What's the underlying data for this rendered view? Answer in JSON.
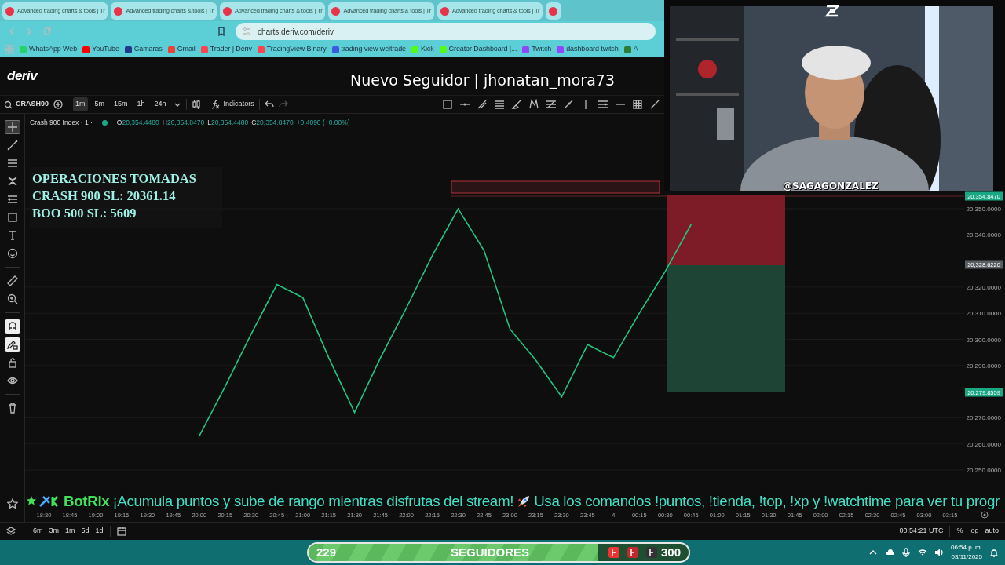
{
  "browser": {
    "tabs": [
      {
        "title": "Advanced trading charts & tools | Tr",
        "selected": false
      },
      {
        "title": "Advanced trading charts & tools | Tr",
        "selected": false
      },
      {
        "title": "Advanced trading charts & tools | Tr",
        "selected": false
      },
      {
        "title": "Advanced trading charts & tools | Tr",
        "selected": false
      },
      {
        "title": "Advanced trading charts & tools | Tr",
        "selected": false
      },
      {
        "selected": false
      }
    ],
    "address": "charts.deriv.com/deriv",
    "bookmarks": [
      {
        "label": "WhatsApp Web",
        "color": "#25d366"
      },
      {
        "label": "YouTube",
        "color": "#ff0000"
      },
      {
        "label": "Camaras",
        "color": "#1e3a8a"
      },
      {
        "label": "Gmail",
        "color": "#ea4335"
      },
      {
        "label": "Trader | Deriv",
        "color": "#ff444f"
      },
      {
        "label": "TradingView Binary",
        "color": "#ff444f"
      },
      {
        "label": "trading view weltrade",
        "color": "#3b5bdb"
      },
      {
        "label": "Kick",
        "color": "#53fc18"
      },
      {
        "label": "Creator Dashboard |...",
        "color": "#53fc18"
      },
      {
        "label": "Twitch",
        "color": "#9146ff"
      },
      {
        "label": "dashboard twitch",
        "color": "#9146ff"
      },
      {
        "label": "A",
        "color": "#2e7d32"
      }
    ]
  },
  "app": {
    "logo": "deriv"
  },
  "alert": {
    "text": "Nuevo Seguidor | jhonatan_mora73"
  },
  "toolbar": {
    "symbol": "CRASH90",
    "intervals": [
      {
        "label": "1m",
        "selected": true
      },
      {
        "label": "5m",
        "selected": false
      },
      {
        "label": "15m",
        "selected": false
      },
      {
        "label": "1h",
        "selected": false
      },
      {
        "label": "24h",
        "selected": false
      }
    ],
    "indicators": "Indicators"
  },
  "legend": {
    "title": "Crash 900 Index · 1 ·",
    "values": [
      {
        "key": "O",
        "value": "20,354.4480"
      },
      {
        "key": "H",
        "value": "20,354.8470"
      },
      {
        "key": "L",
        "value": "20,354.4480"
      },
      {
        "key": "C",
        "value": "20,354.8470"
      }
    ],
    "change": "+0.4090 (+0.00%)"
  },
  "left_tools": [
    {
      "selected": true,
      "on": false
    },
    {
      "selected": false,
      "on": false
    },
    {
      "selected": false,
      "on": false
    },
    {
      "selected": false,
      "on": false
    },
    {
      "selected": false,
      "on": false
    },
    {
      "selected": false,
      "on": false
    },
    {
      "selected": false,
      "on": false
    },
    {
      "selected": false,
      "on": false
    },
    {
      "selected": false,
      "on": false
    },
    {
      "selected": false,
      "on": false
    },
    {
      "selected": false,
      "on": true
    },
    {
      "selected": false,
      "on": true
    },
    {
      "selected": false,
      "on": false
    },
    {
      "selected": false,
      "on": false
    },
    {
      "selected": false,
      "on": false
    },
    {
      "selected": false,
      "on": false
    }
  ],
  "note": {
    "lines": [
      "OPERACIONES TOMADAS",
      "CRASH 900 SL: 20361.14",
      "BOO 500 SL: 5609"
    ]
  },
  "chart": {
    "chart_data": {
      "type": "line",
      "categories": [
        "18:30",
        "18:45",
        "19:00",
        "19:15",
        "19:30",
        "19:45",
        "20:00",
        "20:15",
        "20:30",
        "20:45",
        "21:00",
        "21:15",
        "21:30",
        "21:45",
        "22:00",
        "22:15",
        "22:30",
        "22:45",
        "23:00",
        "23:15",
        "23:30",
        "23:45",
        "4",
        "00:15",
        "00:30",
        "00:45",
        "01:00",
        "01:15",
        "01:30",
        "01:45",
        "02:00",
        "02:15",
        "02:30",
        "02:45",
        "03:00",
        "03:15"
      ],
      "grid": true,
      "ylim": [
        20250,
        20350
      ],
      "series": [
        {
          "color": "#1fc77e",
          "values": [
            null,
            null,
            null,
            null,
            null,
            null,
            20263,
            20282,
            20302,
            20321,
            20316,
            20293,
            20272,
            20293,
            20312,
            20332,
            20350,
            20334,
            20304,
            20292,
            20278,
            20298,
            20293,
            20310,
            20326,
            20344,
            null,
            null,
            null,
            null,
            null,
            null,
            null,
            null,
            null,
            null
          ]
        }
      ],
      "yticks": [
        {
          "value": 20250,
          "label": "20,250.0000"
        },
        {
          "value": 20260,
          "label": "20,260.0000"
        },
        {
          "value": 20270,
          "label": "20,270.0000"
        },
        {
          "value": 20290,
          "label": "20,290.0000"
        },
        {
          "value": 20300,
          "label": "20,300.0000"
        },
        {
          "value": 20310,
          "label": "20,310.0000"
        },
        {
          "value": 20320,
          "label": "20,320.0000"
        },
        {
          "value": 20340,
          "label": "20,340.0000"
        },
        {
          "value": 20350,
          "label": "20,350.0000"
        }
      ]
    },
    "price_badges": [
      {
        "text": "20,354.8470",
        "kind": "last"
      },
      {
        "text": "20,328.6220",
        "kind": "position"
      },
      {
        "text": "20,279.8559",
        "kind": "last"
      }
    ]
  },
  "bottom": {
    "ranges": [
      "6m",
      "3m",
      "1m",
      "5d",
      "1d"
    ],
    "clock": "00:54:21 UTC",
    "options": [
      "%",
      "log",
      "auto"
    ]
  },
  "webcam": {
    "kind": "picture",
    "handle": "@SAGAGONZALEZ"
  },
  "banner": {
    "brand": "BotRix",
    "text_before": "¡Acumula puntos y sube de rango mientras disfrutas del stream!",
    "text_after": "Usa los comandos !puntos, !tienda, !top, !xp y !watchtime para ver tu progr"
  },
  "follower_goal": {
    "current": "229",
    "label": "SEGUIDORES",
    "target": "300",
    "level": 0.76
  },
  "taskbar": {
    "time": "06:54 p. m.",
    "date": "03/11/2025"
  }
}
